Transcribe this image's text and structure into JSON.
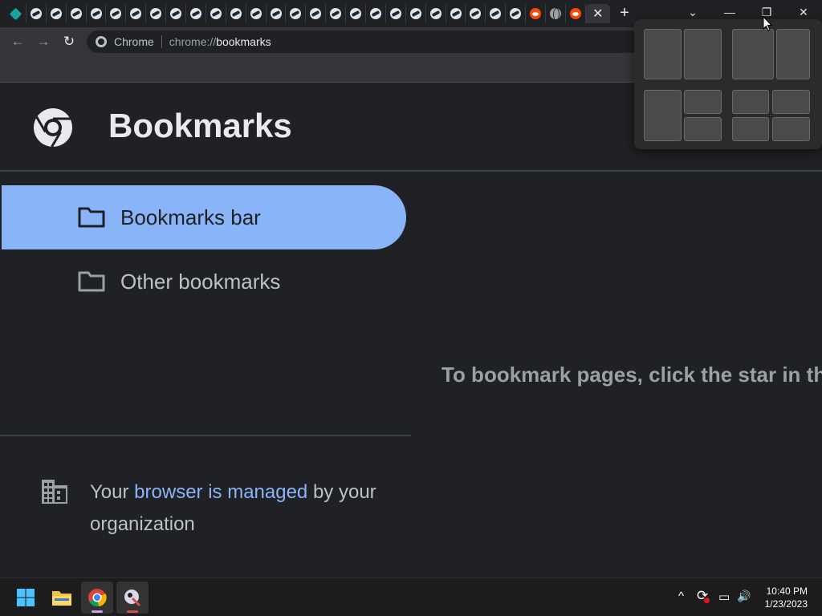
{
  "browser": {
    "tabs": [
      {
        "icon": "tealgem-icon"
      },
      {
        "icon": "steam-icon"
      },
      {
        "icon": "steam-icon"
      },
      {
        "icon": "steam-icon"
      },
      {
        "icon": "steam-icon"
      },
      {
        "icon": "steam-icon"
      },
      {
        "icon": "steam-icon"
      },
      {
        "icon": "steam-icon"
      },
      {
        "icon": "steam-icon"
      },
      {
        "icon": "steam-icon"
      },
      {
        "icon": "steam-icon"
      },
      {
        "icon": "steam-icon"
      },
      {
        "icon": "steam-icon"
      },
      {
        "icon": "steam-icon"
      },
      {
        "icon": "steam-icon"
      },
      {
        "icon": "steam-icon"
      },
      {
        "icon": "steam-icon"
      },
      {
        "icon": "steam-icon"
      },
      {
        "icon": "steam-icon"
      },
      {
        "icon": "steam-icon"
      },
      {
        "icon": "steam-icon"
      },
      {
        "icon": "steam-icon"
      },
      {
        "icon": "steam-icon"
      },
      {
        "icon": "steam-icon"
      },
      {
        "icon": "steam-icon"
      },
      {
        "icon": "steam-icon"
      },
      {
        "icon": "reddit-icon"
      },
      {
        "icon": "globe-icon"
      },
      {
        "icon": "reddit-icon"
      }
    ],
    "active_tab_close": "✕",
    "new_tab": "+",
    "window_controls": {
      "dropdown": "⌄",
      "minimize": "—",
      "restore": "❐",
      "close": "✕"
    },
    "toolbar": {
      "back": "←",
      "forward": "→",
      "reload": "↻",
      "site_chip": "Chrome",
      "url_scheme": "chrome://",
      "url_host": "bookmarks"
    }
  },
  "page": {
    "title": "Bookmarks",
    "folders": [
      {
        "label": "Bookmarks bar",
        "selected": true
      },
      {
        "label": "Other bookmarks",
        "selected": false
      }
    ],
    "managed": {
      "prefix": "Your ",
      "link": "browser is managed",
      "suffix": " by your organization"
    },
    "empty_message": "To bookmark pages, click the star in th"
  },
  "colors": {
    "background": "#202124",
    "accent": "#8ab4f8",
    "toolbar": "#35363a"
  },
  "taskbar": {
    "apps": [
      "windows-start-icon",
      "file-explorer-icon",
      "chrome-icon",
      "app-icon"
    ],
    "tray": {
      "chevron": "^",
      "sync": "⟳",
      "network": "▭",
      "volume": "🔊"
    },
    "time": "10:40 PM",
    "date": "1/23/2023"
  }
}
